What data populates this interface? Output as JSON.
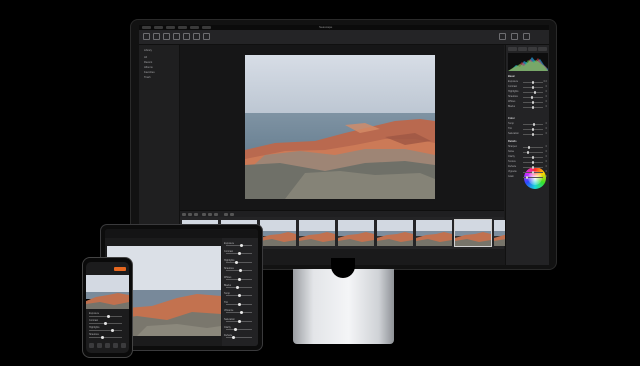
{
  "monitor": {
    "app_title": "Seascape",
    "toolbar": {
      "title": "",
      "subtitle": "",
      "icons": [
        "import-icon",
        "folder-icon",
        "crop-icon",
        "rotate-icon",
        "adjust-icon",
        "brush-icon",
        "compare-icon",
        "share-icon",
        "export-icon"
      ]
    },
    "left_panel": {
      "items": [
        "Library",
        "All",
        "Recent",
        "Albums",
        "Favorites",
        "Trash"
      ]
    },
    "viewer": {
      "zoom_label": ""
    },
    "filmstrip": {
      "thumb_count": 9,
      "selected_index": 7
    },
    "inspector": {
      "sections": [
        {
          "title": "Basic",
          "rows": [
            {
              "label": "Exposure",
              "value": "0.0",
              "level": 0.5
            },
            {
              "label": "Contrast",
              "value": "0",
              "level": 0.5
            },
            {
              "label": "Highlights",
              "value": "0",
              "level": 0.6
            },
            {
              "label": "Shadows",
              "value": "0",
              "level": 0.45
            },
            {
              "label": "Whites",
              "value": "0",
              "level": 0.5
            },
            {
              "label": "Blacks",
              "value": "0",
              "level": 0.5
            }
          ]
        },
        {
          "title": "Color",
          "rows": [
            {
              "label": "Temp",
              "value": "0",
              "level": 0.55
            },
            {
              "label": "Tint",
              "value": "0",
              "level": 0.5
            },
            {
              "label": "Saturation",
              "value": "0",
              "level": 0.5
            }
          ]
        },
        {
          "title": "Details",
          "rows": [
            {
              "label": "Sharpen",
              "value": "0",
              "level": 0.3
            },
            {
              "label": "Noise",
              "value": "0",
              "level": 0.25
            },
            {
              "label": "Clarity",
              "value": "0",
              "level": 0.5
            },
            {
              "label": "Texture",
              "value": "0",
              "level": 0.5
            },
            {
              "label": "Dehaze",
              "value": "0",
              "level": 0.5
            },
            {
              "label": "Vignette",
              "value": "0",
              "level": 0.5
            },
            {
              "label": "Grain",
              "value": "0",
              "level": 0.2
            }
          ]
        }
      ],
      "accent": "#e6671f"
    }
  },
  "tablet": {
    "title": "",
    "panel_rows": [
      {
        "label": "Exposure",
        "level": 0.6
      },
      {
        "label": "Contrast",
        "level": 0.5
      },
      {
        "label": "Highlights",
        "level": 0.4
      },
      {
        "label": "Shadows",
        "level": 0.55
      },
      {
        "label": "Whites",
        "level": 0.5
      },
      {
        "label": "Blacks",
        "level": 0.45
      },
      {
        "label": "Temp",
        "level": 0.5
      },
      {
        "label": "Tint",
        "level": 0.5
      },
      {
        "label": "Vibrance",
        "level": 0.6
      },
      {
        "label": "Saturation",
        "level": 0.5
      },
      {
        "label": "Clarity",
        "level": 0.35
      },
      {
        "label": "Dehaze",
        "level": 0.3
      }
    ]
  },
  "phone": {
    "back_label": "",
    "action_label": "",
    "rows": [
      {
        "label": "Exposure",
        "level": 0.6
      },
      {
        "label": "Contrast",
        "level": 0.5
      },
      {
        "label": "Highlights",
        "level": 0.7
      },
      {
        "label": "Shadows",
        "level": 0.4
      }
    ]
  }
}
